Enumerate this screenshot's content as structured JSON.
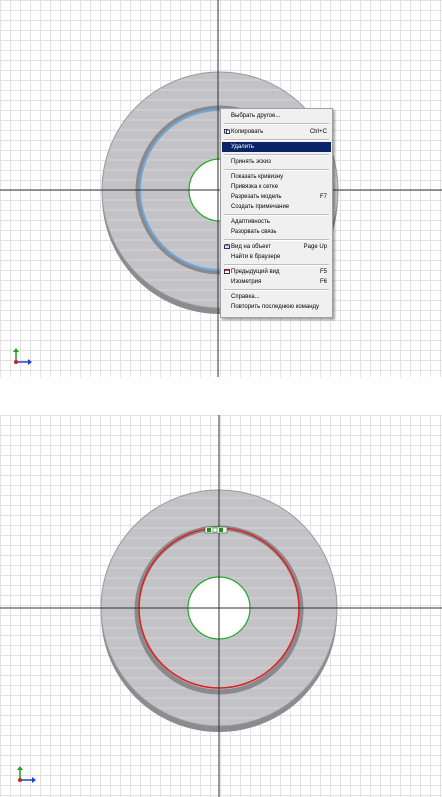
{
  "context_menu": {
    "items": [
      {
        "label": "Выбрать другое...",
        "shortcut": ""
      },
      {
        "label": "Копировать",
        "shortcut": "Ctrl+C",
        "icon": "copy-icon"
      },
      {
        "label": "Удалить",
        "shortcut": "",
        "selected": true
      },
      {
        "label": "Принять эскиз",
        "shortcut": ""
      },
      {
        "label": "Показать кривизну",
        "shortcut": ""
      },
      {
        "label": "Привязка к сетке",
        "shortcut": ""
      },
      {
        "label": "Разрезать модель",
        "shortcut": "F7"
      },
      {
        "label": "Создать примечание",
        "shortcut": ""
      },
      {
        "label": "Адаптивность",
        "shortcut": ""
      },
      {
        "label": "Разорвать связь",
        "shortcut": ""
      },
      {
        "label": "Вид на объект",
        "shortcut": "Page Up",
        "icon": "view-object-icon"
      },
      {
        "label": "Найти в браузере",
        "shortcut": ""
      },
      {
        "label": "Предыдущий вид",
        "shortcut": "F5",
        "icon": "previous-view-icon"
      },
      {
        "label": "Изометрия",
        "shortcut": "F6"
      },
      {
        "label": "Справка...",
        "shortcut": ""
      },
      {
        "label": "Повторить последнюю команду",
        "shortcut": ""
      }
    ]
  },
  "colors": {
    "selection": "#0a246a",
    "selected_circle": "#5b9bd5",
    "highlight_circle": "#e02020",
    "hole_circle": "#22aa22",
    "disc": "#c0c0c4",
    "axis": "#303030"
  }
}
